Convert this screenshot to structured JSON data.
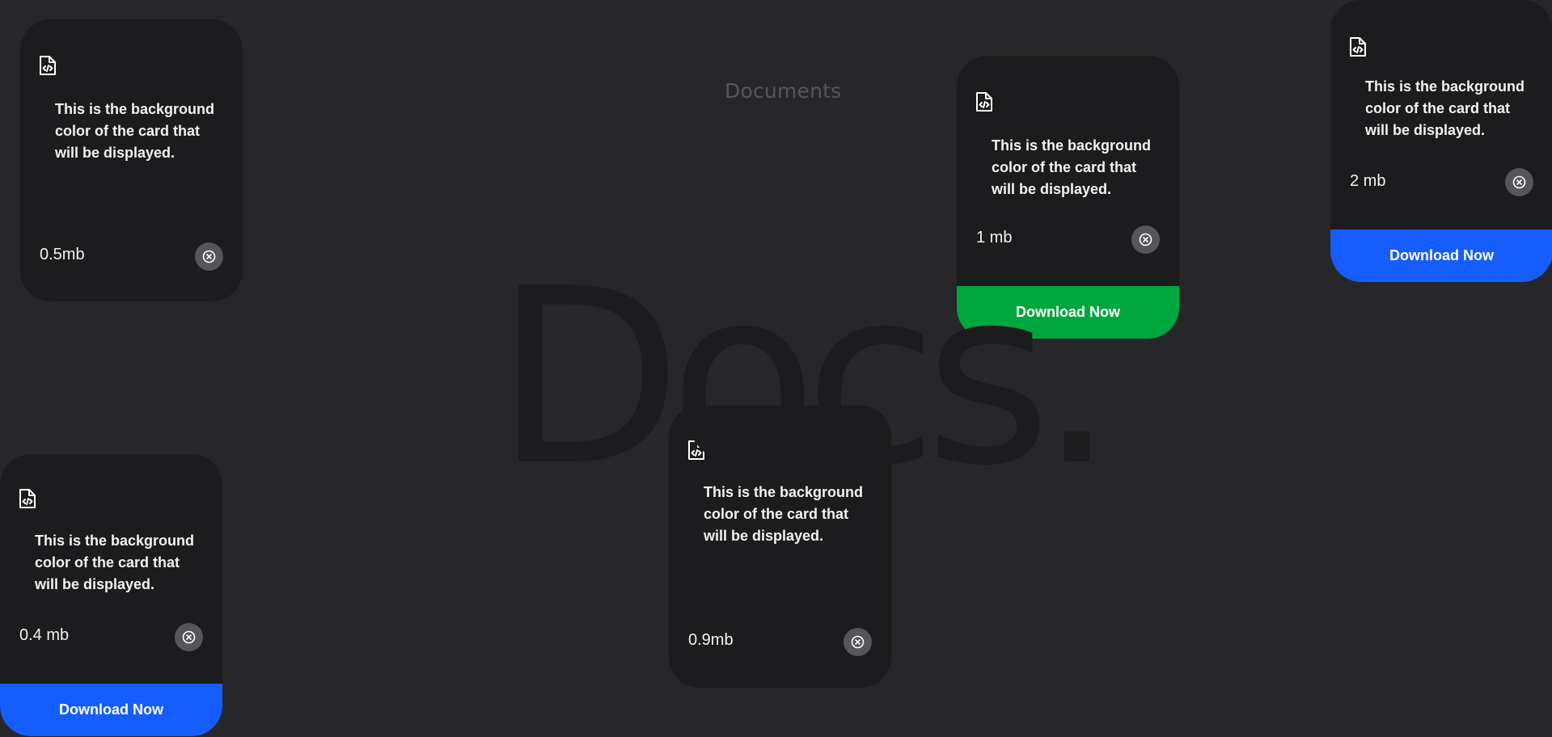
{
  "page": {
    "heading": "Documents",
    "watermark": "Docs."
  },
  "colors": {
    "background": "#27272a",
    "card_background": "#1c1c1e",
    "close_button": "#55555c",
    "download_green": "#00a63e",
    "download_blue": "#155dfc"
  },
  "cards": [
    {
      "description": "This is the background color of the card that will be displayed.",
      "size": "0.5mb",
      "download_label": null,
      "download_color": null
    },
    {
      "description": "This is the background color of the card that will be displayed.",
      "size": "1 mb",
      "download_label": "Download Now",
      "download_color": "#00a63e"
    },
    {
      "description": "This is the background color of the card that will be displayed.",
      "size": "2 mb",
      "download_label": "Download Now",
      "download_color": "#155dfc"
    },
    {
      "description": "This is the background color of the card that will be displayed.",
      "size": "0.4 mb",
      "download_label": "Download Now",
      "download_color": "#155dfc"
    },
    {
      "description": "This is the background color of the card that will be displayed.",
      "size": "0.9mb",
      "download_label": null,
      "download_color": null
    }
  ],
  "icons": {
    "file": "file-code-icon",
    "close": "close-circle-icon"
  }
}
